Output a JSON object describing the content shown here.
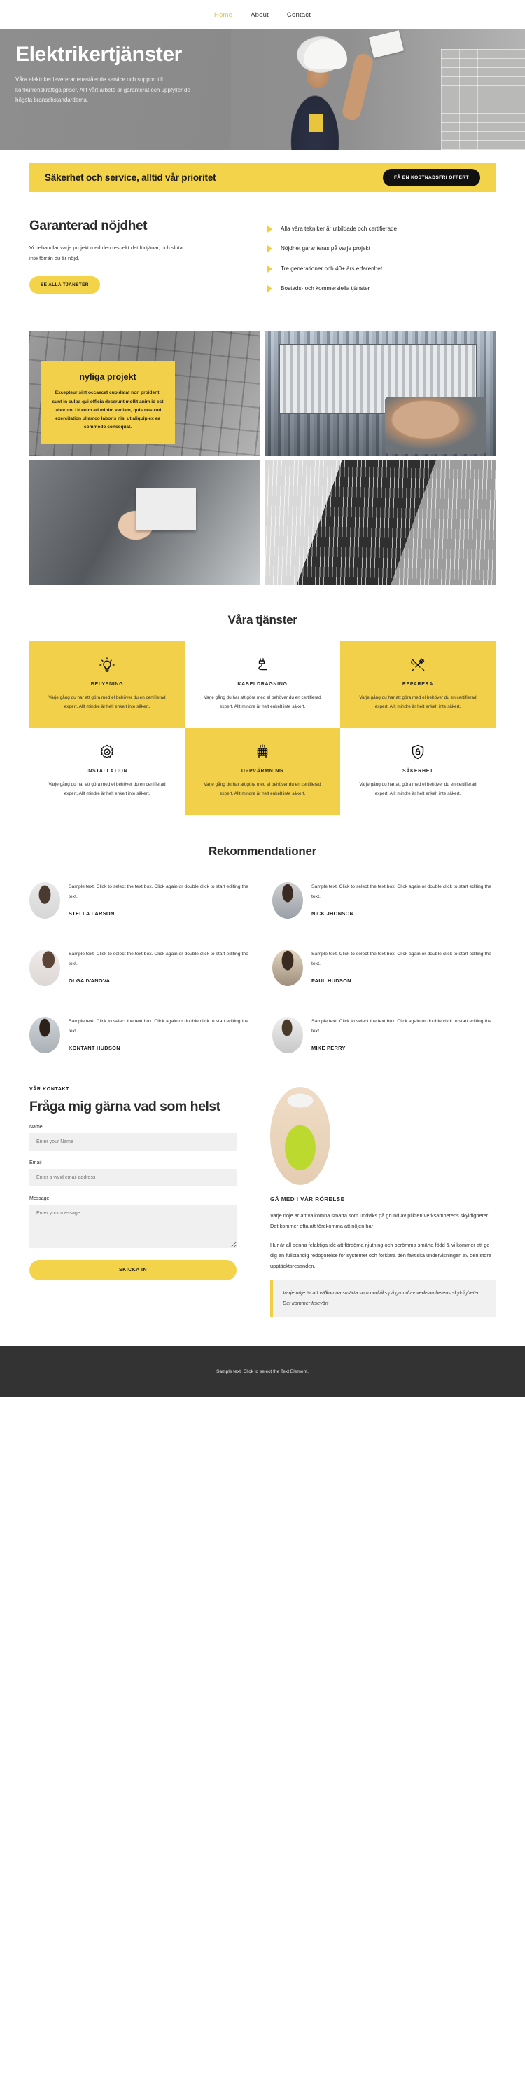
{
  "nav": {
    "items": [
      {
        "label": "Home",
        "active": true
      },
      {
        "label": "About",
        "active": false
      },
      {
        "label": "Contact",
        "active": false
      }
    ]
  },
  "hero": {
    "title": "Elektrikertjänster",
    "paragraph": "Våra elektriker levererar enastående service och support till konkurrenskraftiga priser. Allt vårt arbete är garanterat och uppfyller de högsta branschstandarderna."
  },
  "cta_bar": {
    "headline": "Säkerhet och service, alltid vår prioritet",
    "button": "FÅ EN KOSTNADSFRI OFFERT"
  },
  "guarantee": {
    "title": "Garanterad nöjdhet",
    "paragraph": "Vi behandlar varje projekt med den respekt det förtjänar, och slutar inte förrän du är nöjd.",
    "button": "SE ALLA TJÄNSTER",
    "features": [
      "Alla våra tekniker är utbildade och certifierade",
      "Nöjdhet garanteras på varje projekt",
      "Tre generationer och 40+ års erfarenhet",
      "Bostads- och kommersiella tjänster"
    ]
  },
  "projects_card": {
    "title": "nyliga projekt",
    "text": "Excepteur sint occaecat cupidatat non proident, sunt in culpa qui officia deserunt mollit anim id est laborum. Ut enim ad minim veniam, quis nostrud exercitation ullamco laboris nisi ut aliquip ex ea commodo consequat."
  },
  "services": {
    "title": "Våra tjänster",
    "body": "Varje gång du har att göra med el behöver du en certifierad expert. Allt mindre är helt enkelt inte säkert.",
    "items": [
      {
        "name": "BELYSNING",
        "icon": "lightbulb-icon",
        "highlight": true
      },
      {
        "name": "KABELDRAGNING",
        "icon": "plug-cable-icon",
        "highlight": false
      },
      {
        "name": "REPARERA",
        "icon": "tools-icon",
        "highlight": true
      },
      {
        "name": "INSTALLATION",
        "icon": "gear-check-icon",
        "highlight": false
      },
      {
        "name": "UPPVÄRMNING",
        "icon": "radiator-icon",
        "highlight": true
      },
      {
        "name": "SÄKERHET",
        "icon": "shield-lock-icon",
        "highlight": false
      }
    ]
  },
  "testimonials": {
    "title": "Rekommendationer",
    "body": "Sample text. Click to select the text box. Click again or double click to start editing the text.",
    "people": [
      {
        "name": "STELLA LARSON"
      },
      {
        "name": "NICK JHONSON"
      },
      {
        "name": "OLGA IVANOVA"
      },
      {
        "name": "PAUL HUDSON"
      },
      {
        "name": "KONTANT HUDSON"
      },
      {
        "name": "MIKE PERRY"
      }
    ]
  },
  "contact": {
    "eyebrow": "VÅR KONTAKT",
    "title": "Fråga mig gärna vad som helst",
    "fields": {
      "name_label": "Name",
      "name_placeholder": "Enter your Name",
      "email_label": "Email",
      "email_placeholder": "Enter a valid email address",
      "message_label": "Message",
      "message_placeholder": "Enter your message"
    },
    "submit": "SKICKA IN",
    "side": {
      "heading": "GÅ MED I VÅR RÖRELSE",
      "paragraph1": "Varje nöje är att välkomna smärta som undviks på grund av plikten verksamhetens skyldigheter Det kommer ofta att förekomma att nöjen har",
      "paragraph2": "Hur är all denna felaktiga idé att fördöma njutning och berömma smärta född & vi kommer att ge dig en fullständig redogörelse för systemet och förklara den faktiska undervisningen av den store upptäcktsresanden.",
      "quote": "Varje nöje är att välkomna smärta som undviks på grund av verksamhetens skyldigheter. Det kommer frsevärt"
    }
  },
  "footer": {
    "text": "Sample text. Click to select the Text Element."
  },
  "colors": {
    "accent": "#f3d34a",
    "dark": "#333333",
    "nav_active": "#e8c33c"
  }
}
